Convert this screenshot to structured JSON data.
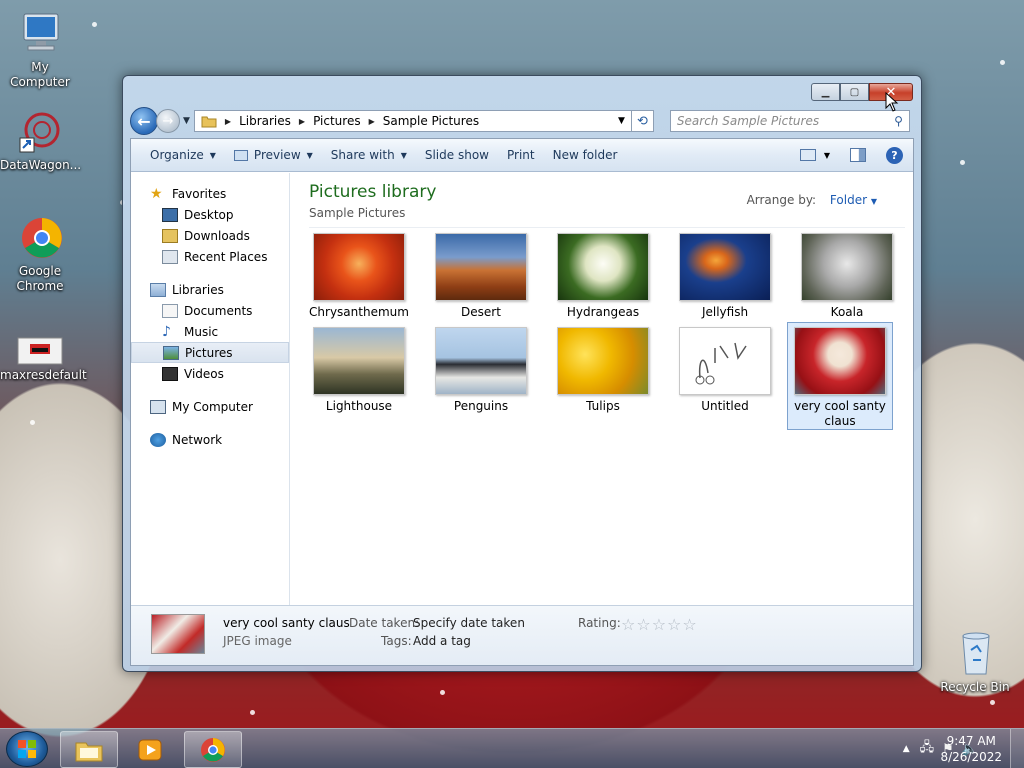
{
  "desktop": {
    "icons": [
      {
        "label": "My Computer"
      },
      {
        "label": "DataWagon..."
      },
      {
        "label": "Google Chrome"
      },
      {
        "label": "maxresdefault"
      },
      {
        "label": "Recycle Bin"
      }
    ]
  },
  "window": {
    "address": {
      "crumbs": [
        "Libraries",
        "Pictures",
        "Sample Pictures"
      ]
    },
    "search": {
      "placeholder": "Search Sample Pictures"
    },
    "toolbar": {
      "organize": "Organize",
      "preview": "Preview",
      "share_with": "Share with",
      "slide_show": "Slide show",
      "print": "Print",
      "new_folder": "New folder"
    },
    "nav": {
      "favorites": "Favorites",
      "desktop": "Desktop",
      "downloads": "Downloads",
      "recent_places": "Recent Places",
      "libraries": "Libraries",
      "documents": "Documents",
      "music": "Music",
      "pictures": "Pictures",
      "videos": "Videos",
      "my_computer": "My Computer",
      "network": "Network"
    },
    "library": {
      "title": "Pictures library",
      "subtitle": "Sample Pictures",
      "arrange_label": "Arrange by:",
      "arrange_value": "Folder"
    },
    "files": [
      {
        "name": "Chrysanthemum"
      },
      {
        "name": "Desert"
      },
      {
        "name": "Hydrangeas"
      },
      {
        "name": "Jellyfish"
      },
      {
        "name": "Koala"
      },
      {
        "name": "Lighthouse"
      },
      {
        "name": "Penguins"
      },
      {
        "name": "Tulips"
      },
      {
        "name": "Untitled"
      },
      {
        "name": "very cool santy claus"
      }
    ],
    "details": {
      "name": "very cool santy claus",
      "type": "JPEG image",
      "date_label": "Date taken:",
      "date_value": "Specify date taken",
      "tags_label": "Tags:",
      "tags_value": "Add a tag",
      "rating_label": "Rating:",
      "rating_stars": "☆☆☆☆☆"
    }
  },
  "taskbar": {
    "time": "9:47 AM",
    "date": "8/26/2022"
  }
}
